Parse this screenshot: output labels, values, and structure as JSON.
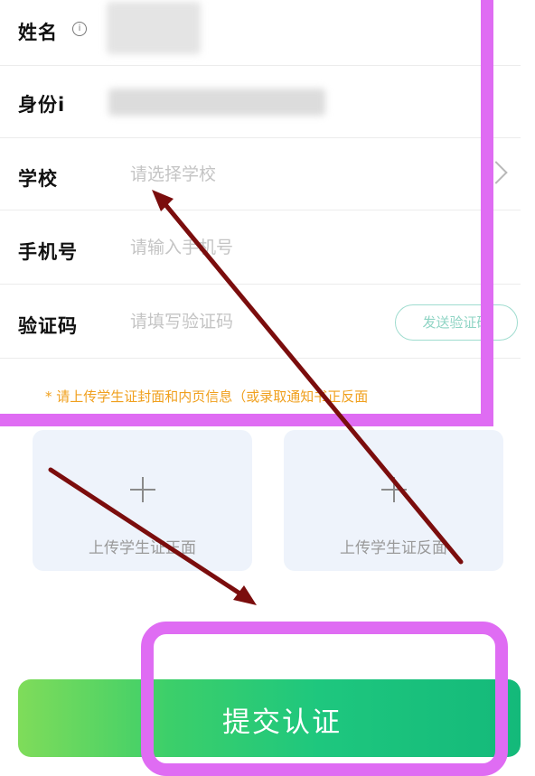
{
  "form": {
    "name_label": "姓名",
    "id_label": "身份i",
    "school_label": "学校",
    "school_placeholder": "请选择学校",
    "phone_label": "手机号",
    "phone_placeholder": "请输入手机号",
    "code_label": "验证码",
    "code_placeholder": "请填写验证码",
    "send_code_label": "发送验证码"
  },
  "notice": "* 请上传学生证封面和内页信息（或录取通知书正反面",
  "upload": {
    "front_label": "上传学生证正面",
    "back_label": "上传学生证反面"
  },
  "submit_label": "提交认证",
  "info_icon": "info-icon",
  "colors": {
    "highlight": "#df6cf3",
    "arrow": "#7b0d0d",
    "accent_green": "#1ec77e",
    "notice_orange": "#f0a01e"
  }
}
